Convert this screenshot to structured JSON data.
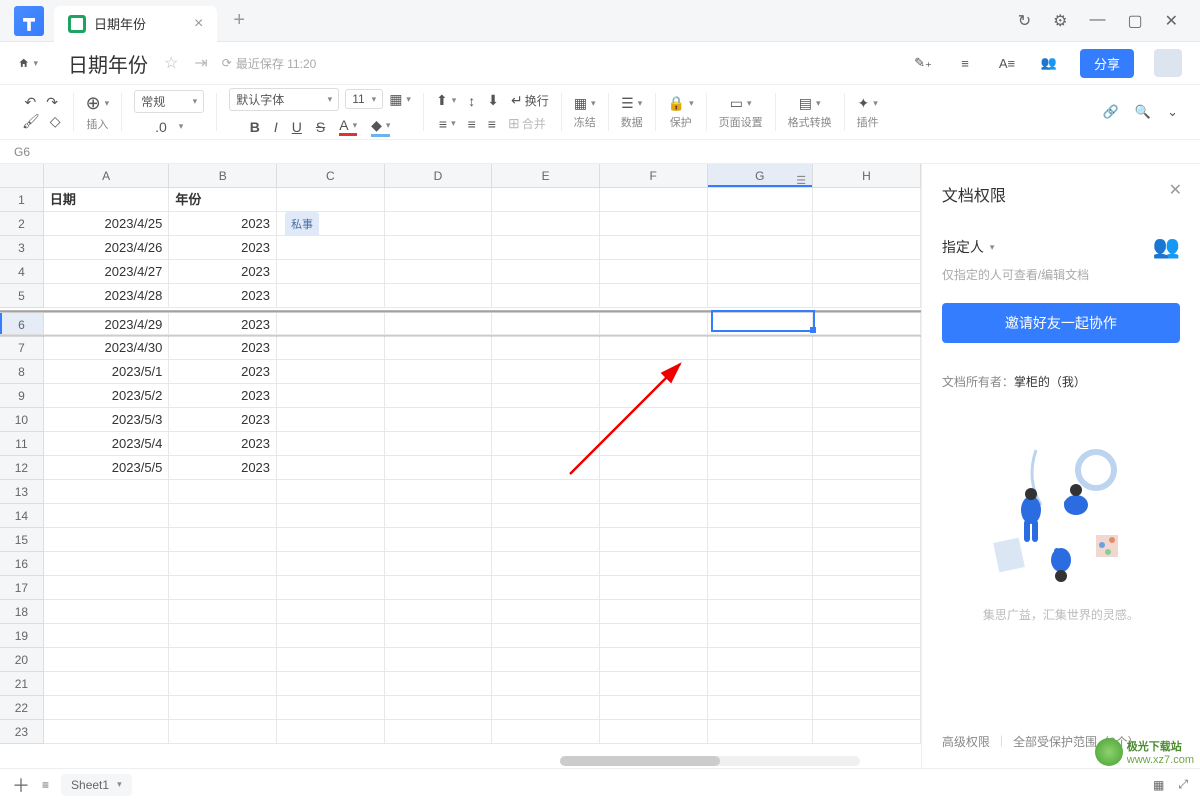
{
  "window": {
    "tab_title": "日期年份",
    "close": "×",
    "add": "+"
  },
  "doc": {
    "title": "日期年份",
    "save_info": "最近保存 11:20"
  },
  "share_label": "分享",
  "toolbar": {
    "insert": "插入",
    "format_select": "常规",
    "decimal_inc": ".0",
    "font_select": "默认字体",
    "size_select": "11",
    "bold": "B",
    "italic": "I",
    "underline": "U",
    "strike": "S",
    "letterA": "A",
    "merge_label": "合并",
    "wrap_label": "换行",
    "freeze": "冻结",
    "data": "数据",
    "protect": "保护",
    "page": "页面设置",
    "convert": "格式转换",
    "plugin": "插件"
  },
  "cellref": "G6",
  "columns": [
    "A",
    "B",
    "C",
    "D",
    "E",
    "F",
    "G",
    "H"
  ],
  "headers": {
    "A": "日期",
    "B": "年份"
  },
  "rows": [
    {
      "n": 1,
      "A": "日期",
      "B": "年份",
      "tag": ""
    },
    {
      "n": 2,
      "A": "2023/4/25",
      "B": "2023",
      "tag": "私事"
    },
    {
      "n": 3,
      "A": "2023/4/26",
      "B": "2023"
    },
    {
      "n": 4,
      "A": "2023/4/27",
      "B": "2023"
    },
    {
      "n": 5,
      "A": "2023/4/28",
      "B": "2023"
    },
    {
      "n": 6,
      "A": "2023/4/29",
      "B": "2023"
    },
    {
      "n": 7,
      "A": "2023/4/30",
      "B": "2023"
    },
    {
      "n": 8,
      "A": "2023/5/1",
      "B": "2023"
    },
    {
      "n": 9,
      "A": "2023/5/2",
      "B": "2023"
    },
    {
      "n": 10,
      "A": "2023/5/3",
      "B": "2023"
    },
    {
      "n": 11,
      "A": "2023/5/4",
      "B": "2023"
    },
    {
      "n": 12,
      "A": "2023/5/5",
      "B": "2023"
    },
    {
      "n": 13,
      "A": "",
      "B": ""
    },
    {
      "n": 14,
      "A": "",
      "B": ""
    },
    {
      "n": 15,
      "A": "",
      "B": ""
    },
    {
      "n": 16,
      "A": "",
      "B": ""
    },
    {
      "n": 17,
      "A": "",
      "B": ""
    },
    {
      "n": 18,
      "A": "",
      "B": ""
    },
    {
      "n": 19,
      "A": "",
      "B": ""
    },
    {
      "n": 20,
      "A": "",
      "B": ""
    },
    {
      "n": 21,
      "A": "",
      "B": ""
    },
    {
      "n": 22,
      "A": "",
      "B": ""
    },
    {
      "n": 23,
      "A": "",
      "B": ""
    }
  ],
  "panel": {
    "title": "文档权限",
    "assign_label": "指定人",
    "desc": "仅指定的人可查看/编辑文档",
    "invite": "邀请好友一起协作",
    "owner_label": "文档所有者：",
    "owner_name": "掌柜的（我）",
    "caption": "集思广益，汇集世界的灵感。",
    "adv": "高级权限",
    "scope": "全部受保护范围（0个）"
  },
  "footer": {
    "sheet": "Sheet1"
  },
  "watermark": {
    "site": "极光下载站",
    "url": "www.xz7.com"
  }
}
